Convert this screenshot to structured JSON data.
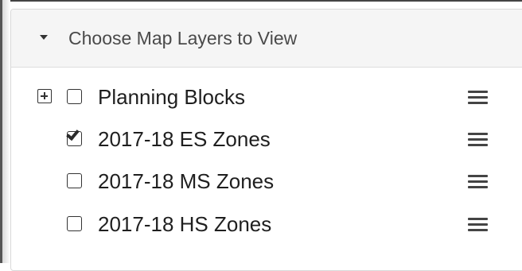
{
  "panel": {
    "title": "Choose Map Layers to View",
    "expanded": true
  },
  "layers": [
    {
      "label": "Planning Blocks",
      "checked": false,
      "expandable": true
    },
    {
      "label": "2017-18 ES Zones",
      "checked": true,
      "expandable": false
    },
    {
      "label": "2017-18 MS Zones",
      "checked": false,
      "expandable": false
    },
    {
      "label": "2017-18 HS Zones",
      "checked": false,
      "expandable": false
    }
  ],
  "icons": {
    "header": "caret-down-icon",
    "expand": "plus-square-icon",
    "menu": "hamburger-menu-icon"
  },
  "colors": {
    "header_bg": "#f5f5f5",
    "border": "#d9d9d9",
    "text": "#1f1f1f",
    "title_text": "#4a4a4a"
  }
}
